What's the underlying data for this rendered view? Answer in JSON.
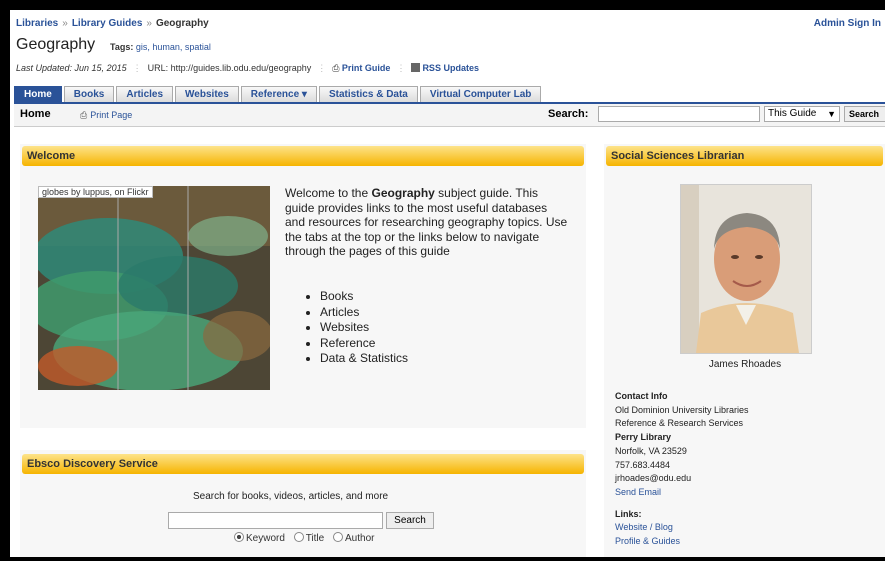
{
  "breadcrumb": [
    "Libraries",
    "Library Guides",
    "Geography"
  ],
  "admin_link": "Admin Sign In",
  "guide": {
    "title": "Geography",
    "tags_label": "Tags:",
    "tags": "gis, human, spatial",
    "last_updated": "Last Updated: Jun 15, 2015",
    "url": "URL: http://guides.lib.odu.edu/geography",
    "print_guide": "Print Guide",
    "rss": "RSS Updates"
  },
  "tabs": [
    "Home",
    "Books",
    "Articles",
    "Websites",
    "Reference ▾",
    "Statistics & Data",
    "Virtual Computer Lab"
  ],
  "subbar": {
    "home": "Home",
    "print_page": "Print Page",
    "search_label": "Search:",
    "search_scope": "This Guide",
    "search_button": "Search"
  },
  "welcome": {
    "header": "Welcome",
    "image_caption": "globes by luppus, on Flickr",
    "text_1": "Welcome to the ",
    "text_bold": "Geography",
    "text_2": " subject guide. This guide provides links to the most useful databases and resources for researching geography topics. Use the tabs at the top or the links below to navigate through the pages of this guide",
    "list": [
      "Books",
      "Articles",
      "Websites",
      "Reference",
      "Data & Statistics"
    ]
  },
  "eds": {
    "header": "Ebsco Discovery Service",
    "intro": "Search for books, videos, articles, and more",
    "button": "Search",
    "options": [
      "Keyword",
      "Title",
      "Author"
    ]
  },
  "librarian": {
    "header": "Social Sciences Librarian",
    "name": "James Rhoades",
    "contact_label": "Contact Info",
    "contact_lines": [
      "Old Dominion University Libraries",
      "Reference & Research Services"
    ],
    "location_label": "Perry Library",
    "address_lines": [
      "Norfolk, VA 23529",
      "757.683.4484",
      "jrhoades@odu.edu"
    ],
    "send_email": "Send Email",
    "links_label": "Links:",
    "links": [
      "Website / Blog",
      "Profile & Guides"
    ]
  },
  "colors": {
    "accent": "#2a5298",
    "panel_header": "#f6b400"
  }
}
